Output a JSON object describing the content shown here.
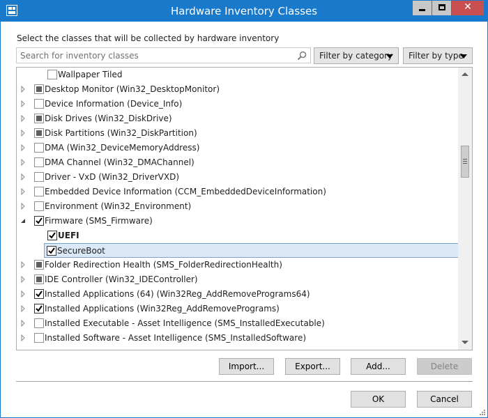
{
  "window": {
    "title": "Hardware Inventory Classes",
    "close_glyph": "✕"
  },
  "description": "Select the classes that will be collected by hardware inventory",
  "search": {
    "placeholder": "Search for inventory classes",
    "value": ""
  },
  "filters": {
    "category_label": "Filter by category",
    "type_label": "Filter by type"
  },
  "tree": {
    "rows": [
      {
        "label": "Wallpaper Tiled",
        "level": 1,
        "expander": "none",
        "check": "unchecked",
        "bold": false,
        "selected": false
      },
      {
        "label": "Desktop Monitor (Win32_DesktopMonitor)",
        "level": 0,
        "expander": "collapsed",
        "check": "partial",
        "bold": false,
        "selected": false
      },
      {
        "label": "Device Information (Device_Info)",
        "level": 0,
        "expander": "collapsed",
        "check": "unchecked",
        "bold": false,
        "selected": false
      },
      {
        "label": "Disk Drives (Win32_DiskDrive)",
        "level": 0,
        "expander": "collapsed",
        "check": "partial",
        "bold": false,
        "selected": false
      },
      {
        "label": "Disk Partitions (Win32_DiskPartition)",
        "level": 0,
        "expander": "collapsed",
        "check": "partial",
        "bold": false,
        "selected": false
      },
      {
        "label": "DMA (Win32_DeviceMemoryAddress)",
        "level": 0,
        "expander": "collapsed",
        "check": "unchecked",
        "bold": false,
        "selected": false
      },
      {
        "label": "DMA Channel (Win32_DMAChannel)",
        "level": 0,
        "expander": "collapsed",
        "check": "unchecked",
        "bold": false,
        "selected": false
      },
      {
        "label": "Driver - VxD (Win32_DriverVXD)",
        "level": 0,
        "expander": "collapsed",
        "check": "unchecked",
        "bold": false,
        "selected": false
      },
      {
        "label": "Embedded Device Information (CCM_EmbeddedDeviceInformation)",
        "level": 0,
        "expander": "collapsed",
        "check": "unchecked",
        "bold": false,
        "selected": false
      },
      {
        "label": "Environment (Win32_Environment)",
        "level": 0,
        "expander": "collapsed",
        "check": "unchecked",
        "bold": false,
        "selected": false
      },
      {
        "label": "Firmware (SMS_Firmware)",
        "level": 0,
        "expander": "expanded",
        "check": "checked",
        "bold": false,
        "selected": false
      },
      {
        "label": "UEFI",
        "level": 1,
        "expander": "none",
        "check": "checked",
        "bold": true,
        "selected": false
      },
      {
        "label": "SecureBoot",
        "level": 1,
        "expander": "none",
        "check": "checked",
        "bold": false,
        "selected": true
      },
      {
        "label": "Folder Redirection Health (SMS_FolderRedirectionHealth)",
        "level": 0,
        "expander": "collapsed",
        "check": "partial",
        "bold": false,
        "selected": false
      },
      {
        "label": "IDE Controller (Win32_IDEController)",
        "level": 0,
        "expander": "collapsed",
        "check": "partial",
        "bold": false,
        "selected": false
      },
      {
        "label": "Installed Applications (64) (Win32Reg_AddRemovePrograms64)",
        "level": 0,
        "expander": "collapsed",
        "check": "checked",
        "bold": false,
        "selected": false
      },
      {
        "label": "Installed Applications (Win32Reg_AddRemovePrograms)",
        "level": 0,
        "expander": "collapsed",
        "check": "checked",
        "bold": false,
        "selected": false
      },
      {
        "label": "Installed Executable - Asset Intelligence (SMS_InstalledExecutable)",
        "level": 0,
        "expander": "collapsed",
        "check": "unchecked",
        "bold": false,
        "selected": false
      },
      {
        "label": "Installed Software - Asset Intelligence (SMS_InstalledSoftware)",
        "level": 0,
        "expander": "collapsed",
        "check": "unchecked",
        "bold": false,
        "selected": false
      }
    ]
  },
  "buttons": {
    "import": "Import...",
    "export": "Export...",
    "add": "Add...",
    "delete": "Delete",
    "ok": "OK",
    "cancel": "Cancel"
  },
  "colors": {
    "title_bar": "#1979ca",
    "close_button": "#c74f50",
    "selection": "#dbe8f7"
  }
}
